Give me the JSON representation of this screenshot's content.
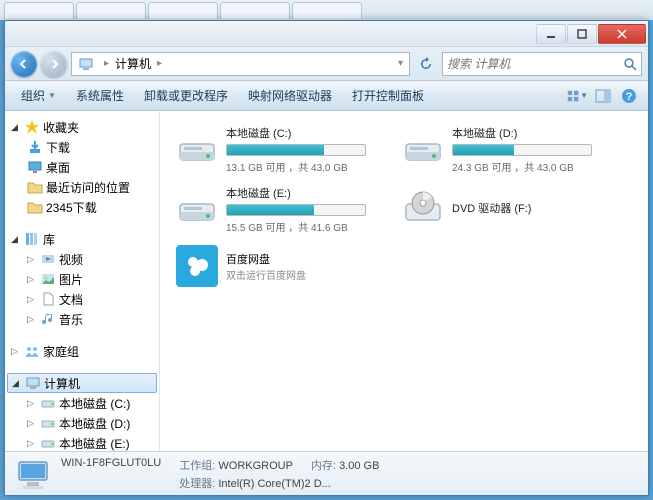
{
  "titlebar": {},
  "nav": {
    "breadcrumb_root": "计算机",
    "search_placeholder": "搜索 计算机"
  },
  "toolbar": {
    "organize": "组织",
    "system_props": "系统属性",
    "uninstall": "卸载或更改程序",
    "map_drive": "映射网络驱动器",
    "control_panel": "打开控制面板"
  },
  "sidebar": {
    "favorites": {
      "label": "收藏夹",
      "items": [
        "下载",
        "桌面",
        "最近访问的位置",
        "2345下载"
      ]
    },
    "libraries": {
      "label": "库",
      "items": [
        "视频",
        "图片",
        "文档",
        "音乐"
      ]
    },
    "homegroup": {
      "label": "家庭组"
    },
    "computer": {
      "label": "计算机",
      "items": [
        "本地磁盘 (C:)",
        "本地磁盘 (D:)",
        "本地磁盘 (E:)"
      ]
    }
  },
  "drives": [
    {
      "name": "本地磁盘 (C:)",
      "free": "13.1 GB",
      "total": "43.0 GB",
      "fill": 70
    },
    {
      "name": "本地磁盘 (D:)",
      "free": "24.3 GB",
      "total": "43.0 GB",
      "fill": 44
    },
    {
      "name": "本地磁盘 (E:)",
      "free": "15.5 GB",
      "total": "41.6 GB",
      "fill": 63
    }
  ],
  "dvd": {
    "name": "DVD 驱动器 (F:)"
  },
  "app": {
    "name": "百度网盘",
    "sub": "双击运行百度网盘"
  },
  "drive_stats_template": {
    "free_word": "可用",
    "sep": "，共"
  },
  "status": {
    "computer_name": "WIN-1F8FGLUT0LU",
    "workgroup_label": "工作组:",
    "workgroup": "WORKGROUP",
    "cpu_label": "处理器:",
    "cpu": "Intel(R) Core(TM)2 D...",
    "mem_label": "内存:",
    "mem": "3.00 GB"
  }
}
